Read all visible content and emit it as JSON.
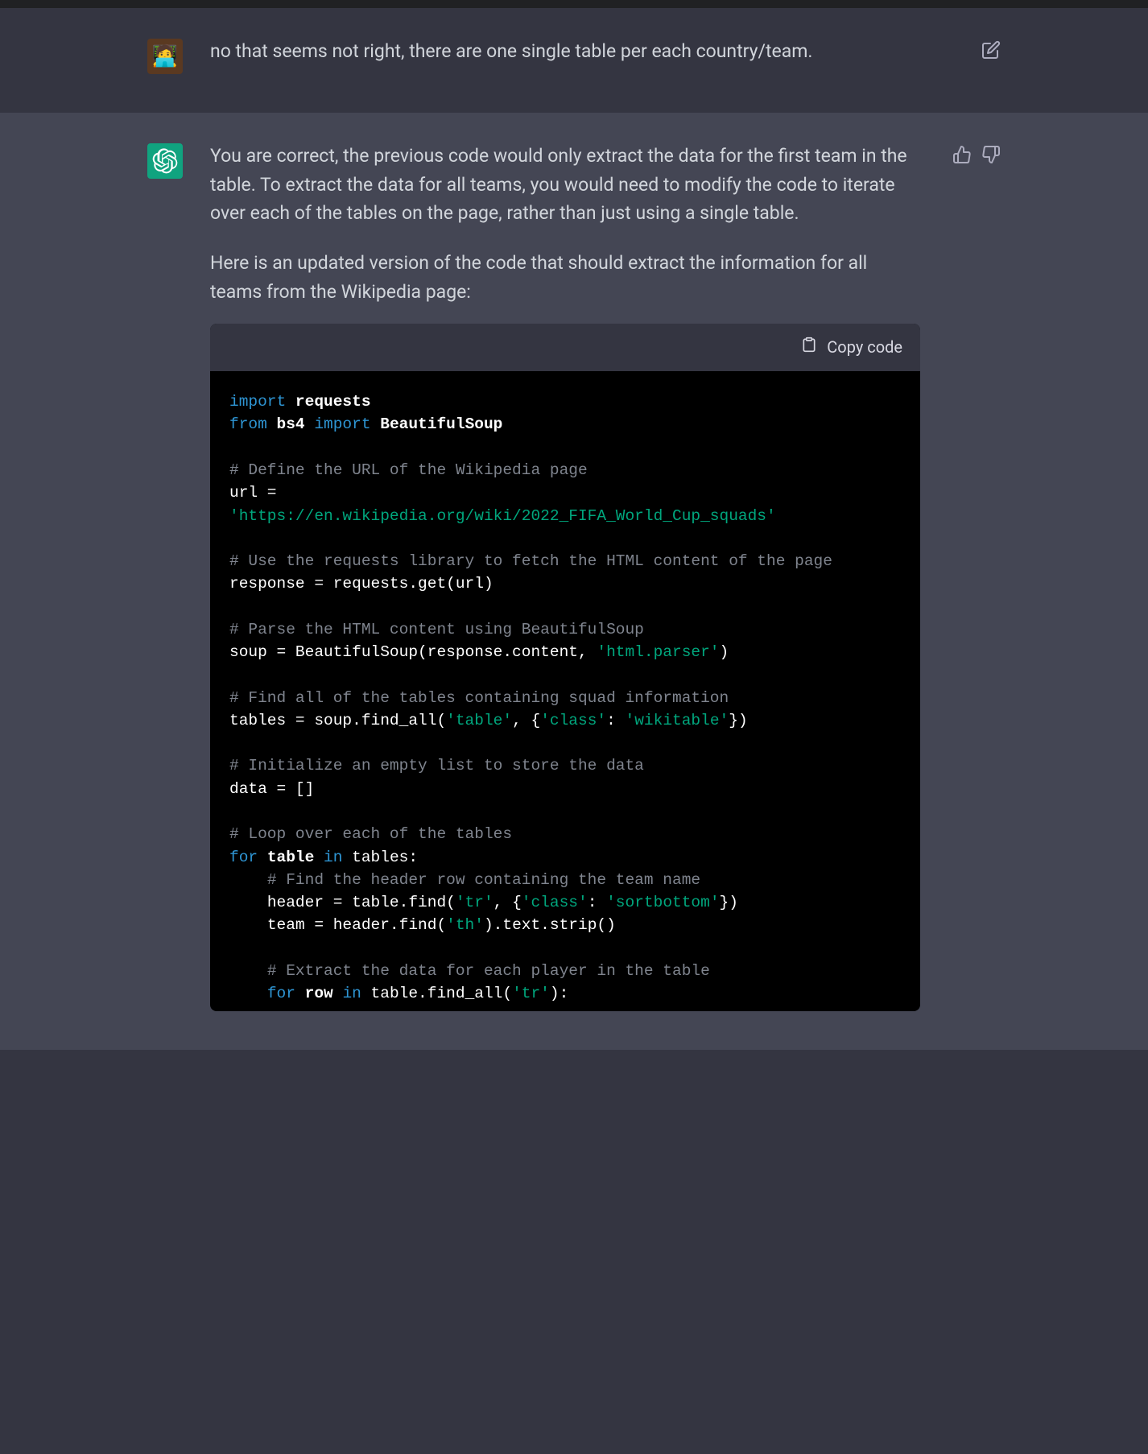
{
  "user_message": {
    "text": "no that seems not right, there are one single table per each country/team."
  },
  "assistant_message": {
    "para1": "You are correct, the previous code would only extract the data for the first team in the table. To extract the data for all teams, you would need to modify the code to iterate over each of the tables on the page, rather than just using a single table.",
    "para2": "Here is an updated version of the code that should extract the information for all teams from the Wikipedia page:"
  },
  "code_block": {
    "copy_label": "Copy code",
    "l1_kw1": "import",
    "l1_id1": "requests",
    "l2_kw1": "from",
    "l2_id1": "bs4",
    "l2_kw2": "import",
    "l2_id2": "BeautifulSoup",
    "c1": "# Define the URL of the Wikipedia page",
    "l3": "url =",
    "l3_str": "'https://en.wikipedia.org/wiki/2022_FIFA_World_Cup_squads'",
    "c2": "# Use the requests library to fetch the HTML content of the page",
    "l4": "response = requests.get(url)",
    "c3": "# Parse the HTML content using BeautifulSoup",
    "l5a": "soup = BeautifulSoup(response.content, ",
    "l5_str": "'html.parser'",
    "l5b": ")",
    "c4": "# Find all of the tables containing squad information",
    "l6a": "tables = soup.find_all(",
    "l6_str1": "'table'",
    "l6b": ", {",
    "l6_str2": "'class'",
    "l6c": ": ",
    "l6_str3": "'wikitable'",
    "l6d": "})",
    "c5": "# Initialize an empty list to store the data",
    "l7": "data = []",
    "c6": "# Loop over each of the tables",
    "l8_kw1": "for",
    "l8_id1": "table",
    "l8_kw2": "in",
    "l8_id2": "tables:",
    "c7": "# Find the header row containing the team name",
    "l9a": "header = table.find(",
    "l9_str1": "'tr'",
    "l9b": ", {",
    "l9_str2": "'class'",
    "l9c": ": ",
    "l9_str3": "'sortbottom'",
    "l9d": "})",
    "l10a": "team = header.find(",
    "l10_str": "'th'",
    "l10b": ").text.strip()",
    "c8": "# Extract the data for each player in the table",
    "l11_kw1": "for",
    "l11_id1": "row",
    "l11_kw2": "in",
    "l11_t1": "table.find_all(",
    "l11_str": "'tr'",
    "l11_t2": "):"
  }
}
